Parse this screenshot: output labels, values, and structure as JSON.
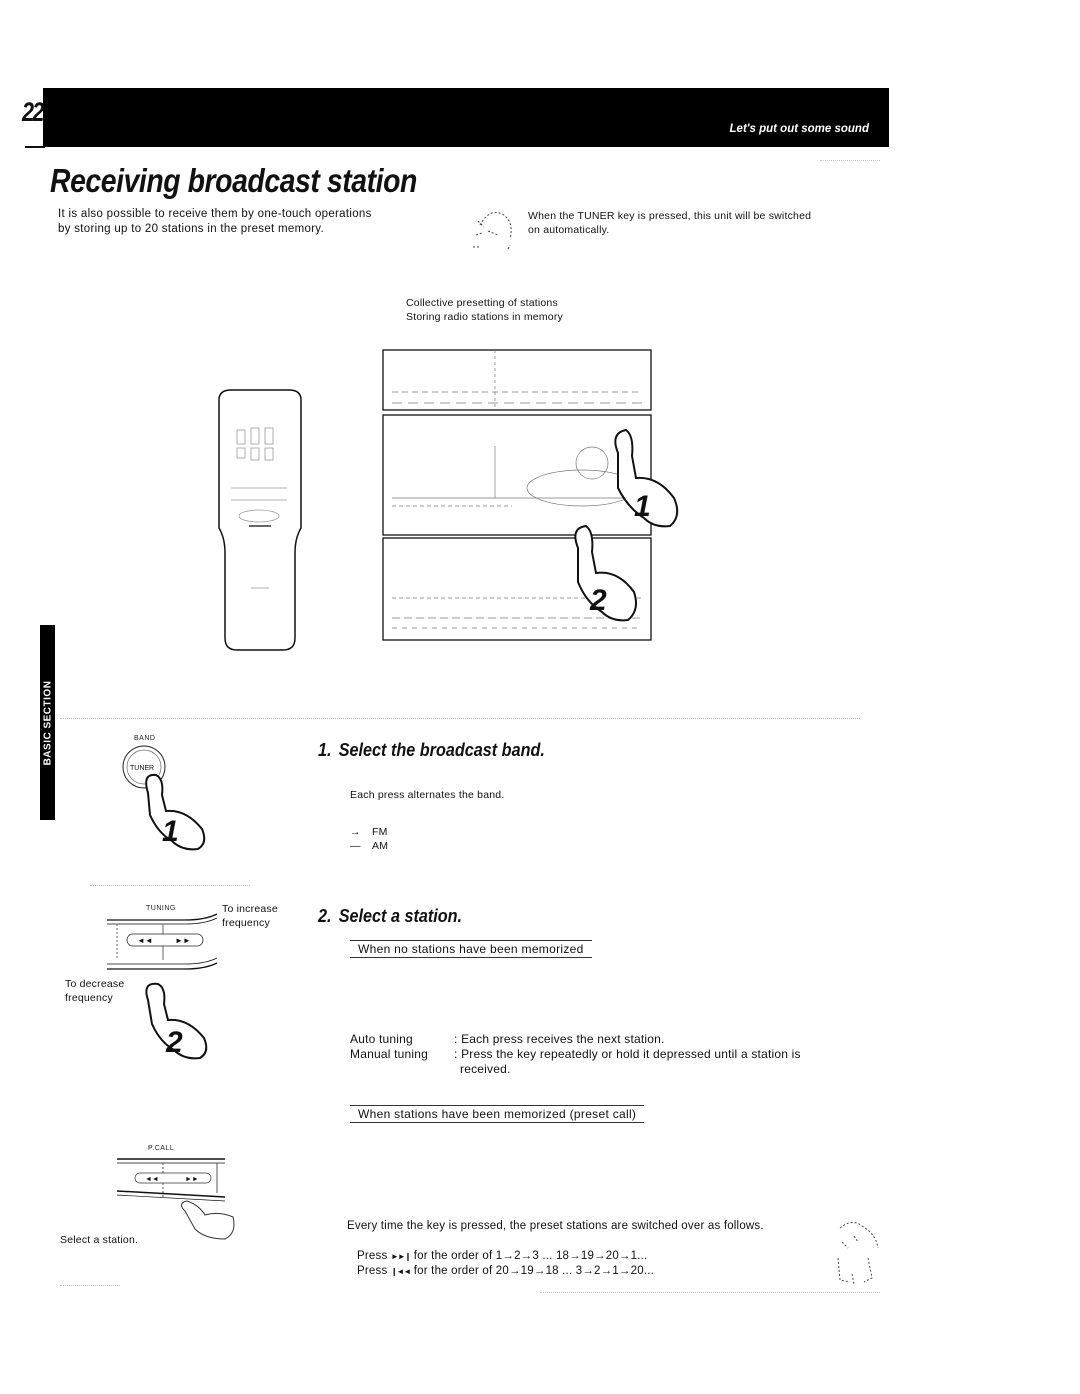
{
  "header": {
    "page_number": "22",
    "section_title": "Let's put out some sound"
  },
  "page_title": "Receiving broadcast station",
  "intro": {
    "left_line1": "It is also possible to receive them by one-touch operations",
    "left_line2": "by storing up to 20 stations in the preset memory.",
    "right_line1": "When the TUNER key is pressed, this unit will be switched",
    "right_line2": "on automatically."
  },
  "figure_caption": {
    "line1": "Collective presetting of stations",
    "line2": "Storing radio stations in memory"
  },
  "side_tab": {
    "label": "BASIC SECTION"
  },
  "illustrations": {
    "hand_1": "1",
    "hand_2": "2",
    "band_label": "BAND",
    "tuner_button": "TUNER",
    "tuning_label": "TUNING",
    "pcall_label": "P.CALL",
    "to_increase": "To increase frequency",
    "to_increase_l1": "To increase",
    "to_increase_l2": "frequency",
    "to_decrease_l1": "To decrease",
    "to_decrease_l2": "frequency",
    "select_station_caption": "Select a station."
  },
  "step1": {
    "number": "1.",
    "title": "Select the broadcast band.",
    "description": "Each press alternates the band.",
    "bands": [
      "FM",
      "AM"
    ]
  },
  "step2": {
    "number": "2.",
    "title": "Select a station.",
    "no_memory_heading": "When no stations have been memorized",
    "tuning_modes": [
      {
        "label": "Auto tuning",
        "description": ": Each press receives the next station."
      },
      {
        "label": "Manual tuning",
        "description": ": Press the key repeatedly or hold it depressed until a station is",
        "description_cont": "received."
      }
    ],
    "memory_heading": "When stations have been memorized (preset call)",
    "preset_intro": "Every time the key is pressed, the preset stations are switched over as follows.",
    "preset_orders": [
      {
        "prefix": "Press",
        "icon": "next-icon",
        "glyph": "►►❙",
        "text": "for the order of 1→2→3 ... 18→19→20→1..."
      },
      {
        "prefix": "Press",
        "icon": "prev-icon",
        "glyph": "❙◄◄",
        "text": "for the order of 20→19→18 ... 3→2→1→20..."
      }
    ]
  },
  "colors": {
    "ink": "#111111",
    "header_bg": "#000000",
    "header_text": "#ffffff"
  }
}
